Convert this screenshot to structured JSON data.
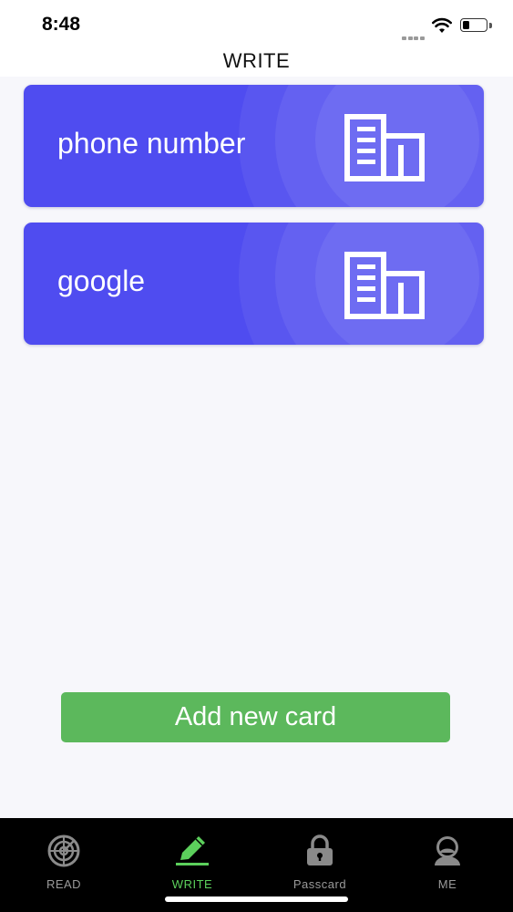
{
  "status_bar": {
    "time": "8:48",
    "battery_level": 0.3
  },
  "header": {
    "title": "WRITE"
  },
  "cards": [
    {
      "label": "phone number",
      "icon": "building-icon"
    },
    {
      "label": "google",
      "icon": "building-icon"
    }
  ],
  "add_button": {
    "label": "Add new card"
  },
  "tabs": [
    {
      "label": "READ",
      "icon": "radar-icon",
      "active": false
    },
    {
      "label": "WRITE",
      "icon": "pencil-icon",
      "active": true
    },
    {
      "label": "Passcard",
      "icon": "lock-icon",
      "active": false
    },
    {
      "label": "ME",
      "icon": "user-icon",
      "active": false
    }
  ],
  "colors": {
    "card_background": "#4f4cf0",
    "add_button": "#5cb85c",
    "active_tab": "#5cd05c",
    "inactive_tab": "#9a9a9a",
    "tab_bar_background": "#000000"
  }
}
